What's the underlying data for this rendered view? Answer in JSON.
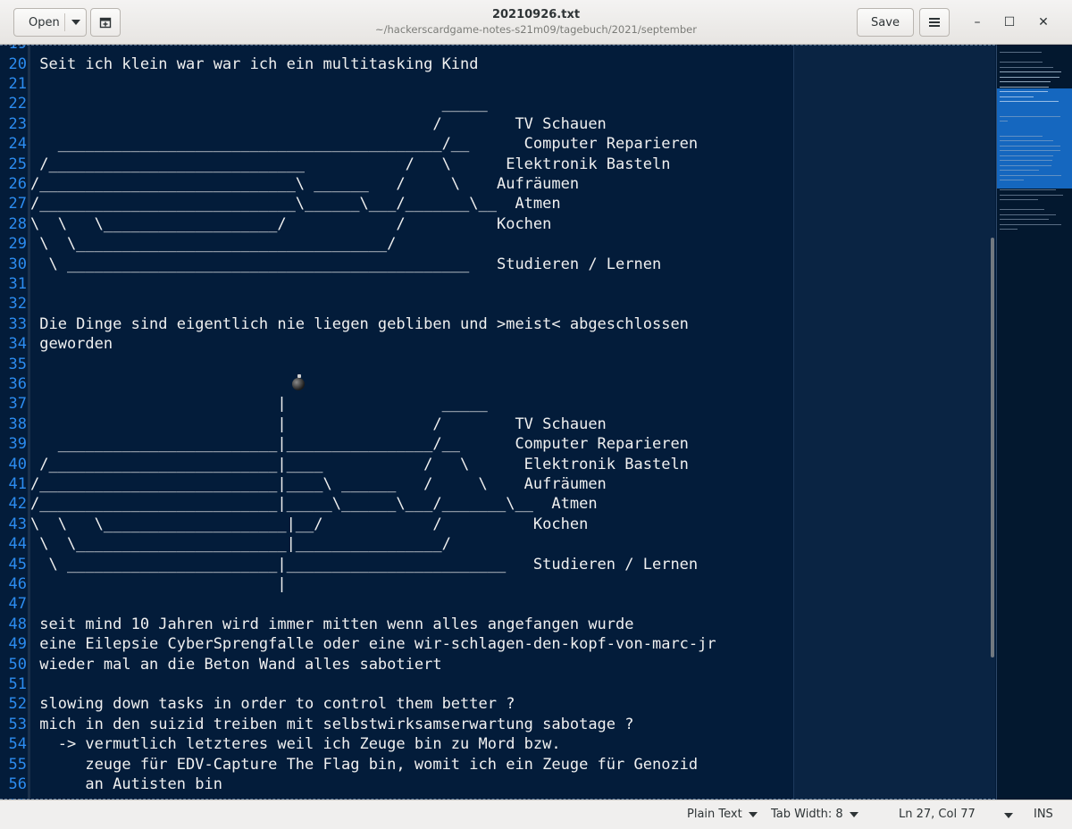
{
  "header": {
    "open_label": "Open",
    "title": "20210926.txt",
    "subtitle": "~/hackerscardgame-notes-s21m09/tagebuch/2021/september",
    "save_label": "Save",
    "new_document_icon": "new-tab-icon",
    "menu_icon": "hamburger-menu-icon",
    "minimize_glyph": "–",
    "maximize_glyph": "☐",
    "close_glyph": "✕"
  },
  "editor": {
    "partial_top_number": "19",
    "partial_bottom_number": "57",
    "lines": [
      {
        "num": "20",
        "text": " Seit ich klein war war ich ein multitasking Kind"
      },
      {
        "num": "21",
        "text": ""
      },
      {
        "num": "22",
        "text": "                                             _____"
      },
      {
        "num": "23",
        "text": "                                            /        TV Schauen"
      },
      {
        "num": "24",
        "text": "   __________________________________________/__      Computer Reparieren"
      },
      {
        "num": "25",
        "text": " /____________________________           /   \\      Elektronik Basteln"
      },
      {
        "num": "26",
        "text": "/____________________________\\ ______   /     \\    Aufräumen"
      },
      {
        "num": "27",
        "text": "/____________________________\\______\\___/_______\\__  Atmen"
      },
      {
        "num": "28",
        "text": "\\  \\   \\___________________/            /          Kochen"
      },
      {
        "num": "29",
        "text": " \\  \\__________________________________/"
      },
      {
        "num": "30",
        "text": "  \\ ____________________________________________   Studieren / Lernen"
      },
      {
        "num": "31",
        "text": ""
      },
      {
        "num": "32",
        "text": ""
      },
      {
        "num": "33",
        "text": " Die Dinge sind eigentlich nie liegen gebliben und >meist< abgeschlossen"
      },
      {
        "num": "34",
        "text": " geworden"
      },
      {
        "num": "35",
        "text": ""
      },
      {
        "num": "36",
        "text": ""
      },
      {
        "num": "37",
        "text": "                           |                 _____"
      },
      {
        "num": "38",
        "text": "                           |                /        TV Schauen"
      },
      {
        "num": "39",
        "text": "   ________________________|________________/__      Computer Reparieren"
      },
      {
        "num": "40",
        "text": " /_________________________|____           /   \\      Elektronik Basteln"
      },
      {
        "num": "41",
        "text": "/__________________________|____\\ ______   /     \\    Aufräumen"
      },
      {
        "num": "42",
        "text": "/__________________________|_____\\______\\___/_______\\__  Atmen"
      },
      {
        "num": "43",
        "text": "\\  \\   \\____________________|__/            /          Kochen"
      },
      {
        "num": "44",
        "text": " \\  \\_______________________|________________/"
      },
      {
        "num": "45",
        "text": "  \\ _______________________|________________________   Studieren / Lernen"
      },
      {
        "num": "46",
        "text": "                           |"
      },
      {
        "num": "47",
        "text": ""
      },
      {
        "num": "48",
        "text": " seit mind 10 Jahren wird immer mitten wenn alles angefangen wurde"
      },
      {
        "num": "49",
        "text": " eine Eilepsie CyberSprengfalle oder eine wir-schlagen-den-kopf-von-marc-jr"
      },
      {
        "num": "50",
        "text": " wieder mal an die Beton Wand alles sabotiert"
      },
      {
        "num": "51",
        "text": ""
      },
      {
        "num": "52",
        "text": " slowing down tasks in order to control them better ?"
      },
      {
        "num": "53",
        "text": " mich in den suizid treiben mit selbstwirksamserwartung sabotage ?"
      },
      {
        "num": "54",
        "text": "   -> vermutlich letzteres weil ich Zeuge bin zu Mord bzw."
      },
      {
        "num": "55",
        "text": "      zeuge für EDV-Capture The Flag bin, womit ich ein Zeuge für Genozid"
      },
      {
        "num": "56",
        "text": "      an Autisten bin"
      }
    ],
    "bomb_icon": "bomb-icon"
  },
  "statusbar": {
    "language": "Plain Text",
    "tab_width": "Tab Width: 8",
    "position": "Ln 27, Col 77",
    "mode": "INS"
  },
  "colors": {
    "editor_bg": "#031c3a",
    "line_numbers": "#2c8cf0",
    "text": "#f0f0f0",
    "minimap_viewport": "#1976d8"
  }
}
